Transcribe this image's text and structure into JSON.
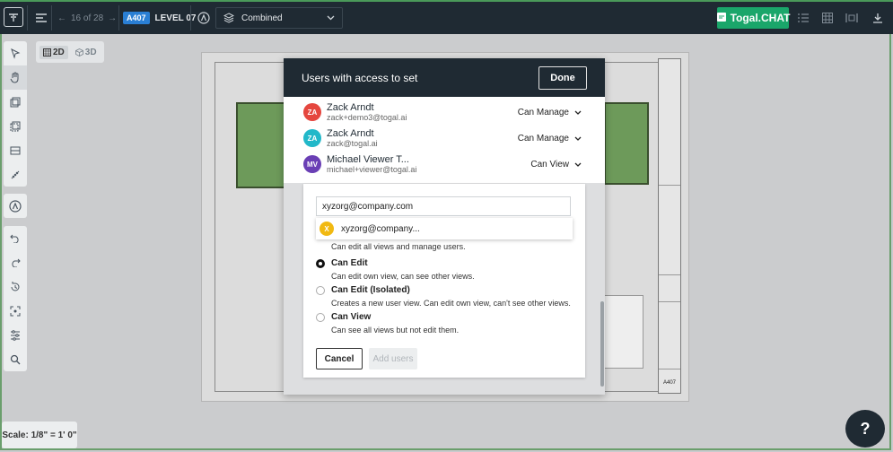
{
  "topbar": {
    "page_counter": "16 of 28",
    "sheet_code": "A407",
    "sheet_name": "LEVEL 07",
    "view_mode": "Combined",
    "chat_label": "Togal.CHAT"
  },
  "view_toggle": {
    "two_d": "2D",
    "three_d": "3D"
  },
  "scale_label": "Scale: 1/8\" = 1' 0\"",
  "help_label": "?",
  "modal": {
    "title": "Users with access to set",
    "done_label": "Done",
    "users": [
      {
        "initials": "ZA",
        "name": "Zack Arndt",
        "email": "zack+demo3@togal.ai",
        "role": "Can Manage",
        "color": "#e5473f"
      },
      {
        "initials": "ZA",
        "name": "Zack Arndt",
        "email": "zack@togal.ai",
        "role": "Can Manage",
        "color": "#22b8c9"
      },
      {
        "initials": "MV",
        "name": "Michael Viewer T...",
        "email": "michael+viewer@togal.ai",
        "role": "Can View",
        "color": "#6a3fb5"
      }
    ]
  },
  "add_user": {
    "email_value": "xyzorg@company.com",
    "suggestion": {
      "initial": "X",
      "label": "xyzorg@company..."
    },
    "manage_desc": "Can edit all views and manage users.",
    "options": [
      {
        "title": "Can Edit",
        "desc": "Can edit own view, can see other views.",
        "selected": true
      },
      {
        "title": "Can Edit (Isolated)",
        "desc": "Creates a new user view. Can edit own view, can't see other views.",
        "selected": false
      },
      {
        "title": "Can View",
        "desc": "Can see all views but not edit them.",
        "selected": false
      }
    ],
    "cancel_label": "Cancel",
    "add_label": "Add users"
  },
  "drawing": {
    "sheet_label": "A407"
  }
}
